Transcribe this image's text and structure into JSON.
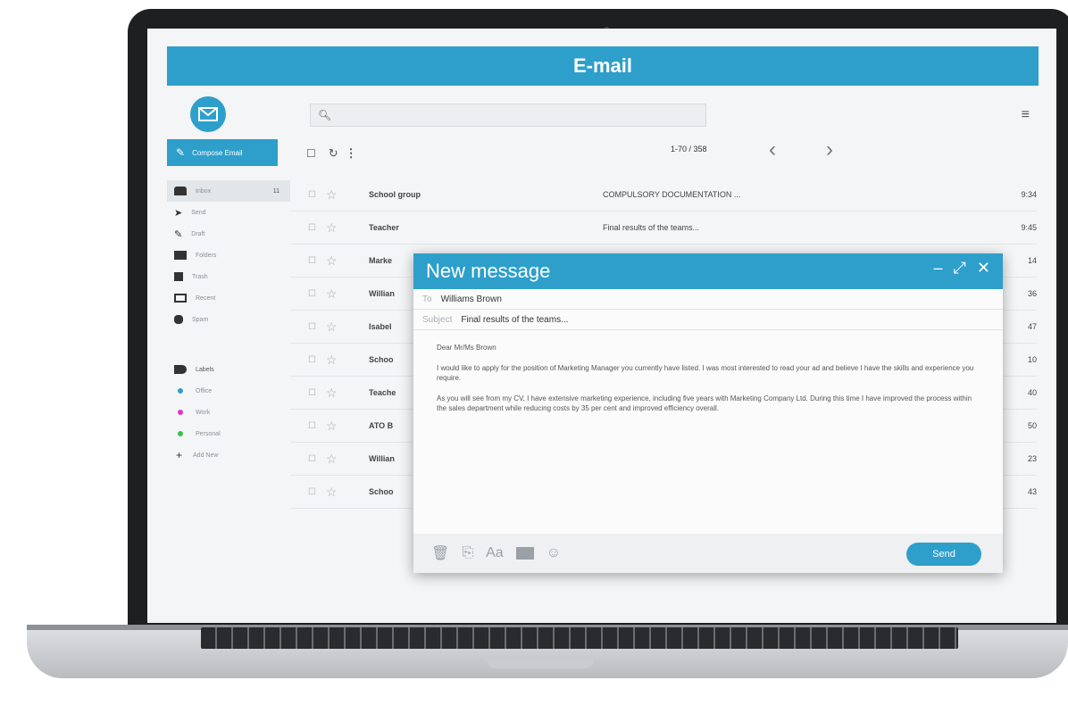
{
  "app": {
    "title": "E-mail"
  },
  "sidebar": {
    "compose_label": "Compose Email",
    "items": [
      {
        "label": "Inbox",
        "count": "11"
      },
      {
        "label": "Send"
      },
      {
        "label": "Draft"
      },
      {
        "label": "Folders"
      },
      {
        "label": "Trash"
      },
      {
        "label": "Recent"
      },
      {
        "label": "Spam"
      }
    ],
    "labels_title": "Labels",
    "labels": [
      {
        "label": "Office",
        "color": "#2e9fcb"
      },
      {
        "label": "Work",
        "color": "#e236c8"
      },
      {
        "label": "Personal",
        "color": "#3bbf4a"
      }
    ],
    "add_label": "Add New"
  },
  "toolbar": {
    "pager": "1-70 / 358",
    "prev_icon": "chevron-left-icon",
    "next_icon": "chevron-right-icon"
  },
  "emails": [
    {
      "sender": "School group",
      "subject": "COMPULSORY DOCUMENTATION ...",
      "time": "9:34"
    },
    {
      "sender": "Teacher",
      "subject": "Final results of the teams...",
      "time": "9:45"
    },
    {
      "sender": "Marke",
      "subject": "",
      "time": "14"
    },
    {
      "sender": "Willian",
      "subject": "",
      "time": "36"
    },
    {
      "sender": "Isabel",
      "subject": "",
      "time": "47"
    },
    {
      "sender": "Schoo",
      "subject": "",
      "time": "10"
    },
    {
      "sender": "Teache",
      "subject": "",
      "time": "40"
    },
    {
      "sender": "ATO B",
      "subject": "",
      "time": "50"
    },
    {
      "sender": "Willian",
      "subject": "",
      "time": "23"
    },
    {
      "sender": "Schoo",
      "subject": "",
      "time": "43"
    }
  ],
  "compose": {
    "title": "New message",
    "to_label": "To",
    "to_value": "Williams Brown",
    "subject_label": "Subject",
    "subject_value": "Final results of the teams...",
    "greeting": "Dear Mr/Ms Brown",
    "para1": "I would like to apply for the position of Marketing Manager you currently have listed. I was most interested to read your ad and believe I have the skills and experience you require.",
    "para2": "As you will see from my CV, I have extensive marketing experience, including five years with Marketing Company Ltd. During this time I have improved the process within the sales department while reducing costs by 35 per cent and improved efficiency overall.",
    "send_label": "Send",
    "font_label": "Aa"
  }
}
